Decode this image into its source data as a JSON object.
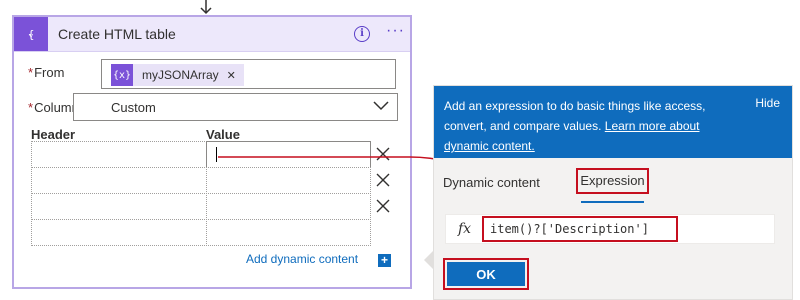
{
  "card": {
    "title": "Create HTML table",
    "from_label": "From",
    "from_token": "myJSONArray",
    "columns_label": "Columns",
    "columns_value": "Custom",
    "header_col": "Header",
    "value_col": "Value",
    "add_dynamic": "Add dynamic content"
  },
  "panel": {
    "banner_text": "Add an expression to do basic things like access, convert, and compare values.",
    "banner_link": "Learn more about dynamic content.",
    "hide_label": "Hide",
    "tabs": {
      "dynamic": "Dynamic content",
      "expression": "Expression"
    },
    "fx_symbol": "fx",
    "expression_value": "item()?['Description']",
    "ok_label": "OK"
  },
  "colors": {
    "accent_purple": "#7b52d8",
    "header_bg": "#ede8fb",
    "brand_blue": "#0f6cbd",
    "highlight_red": "#c50f1f"
  },
  "icons": {
    "card_icon": "variable-icon",
    "token_icon": "variable-icon",
    "info": "info-icon",
    "more": "more-icon",
    "chevron": "chevron-down-icon",
    "delete": "close-icon",
    "add": "plus-icon"
  }
}
